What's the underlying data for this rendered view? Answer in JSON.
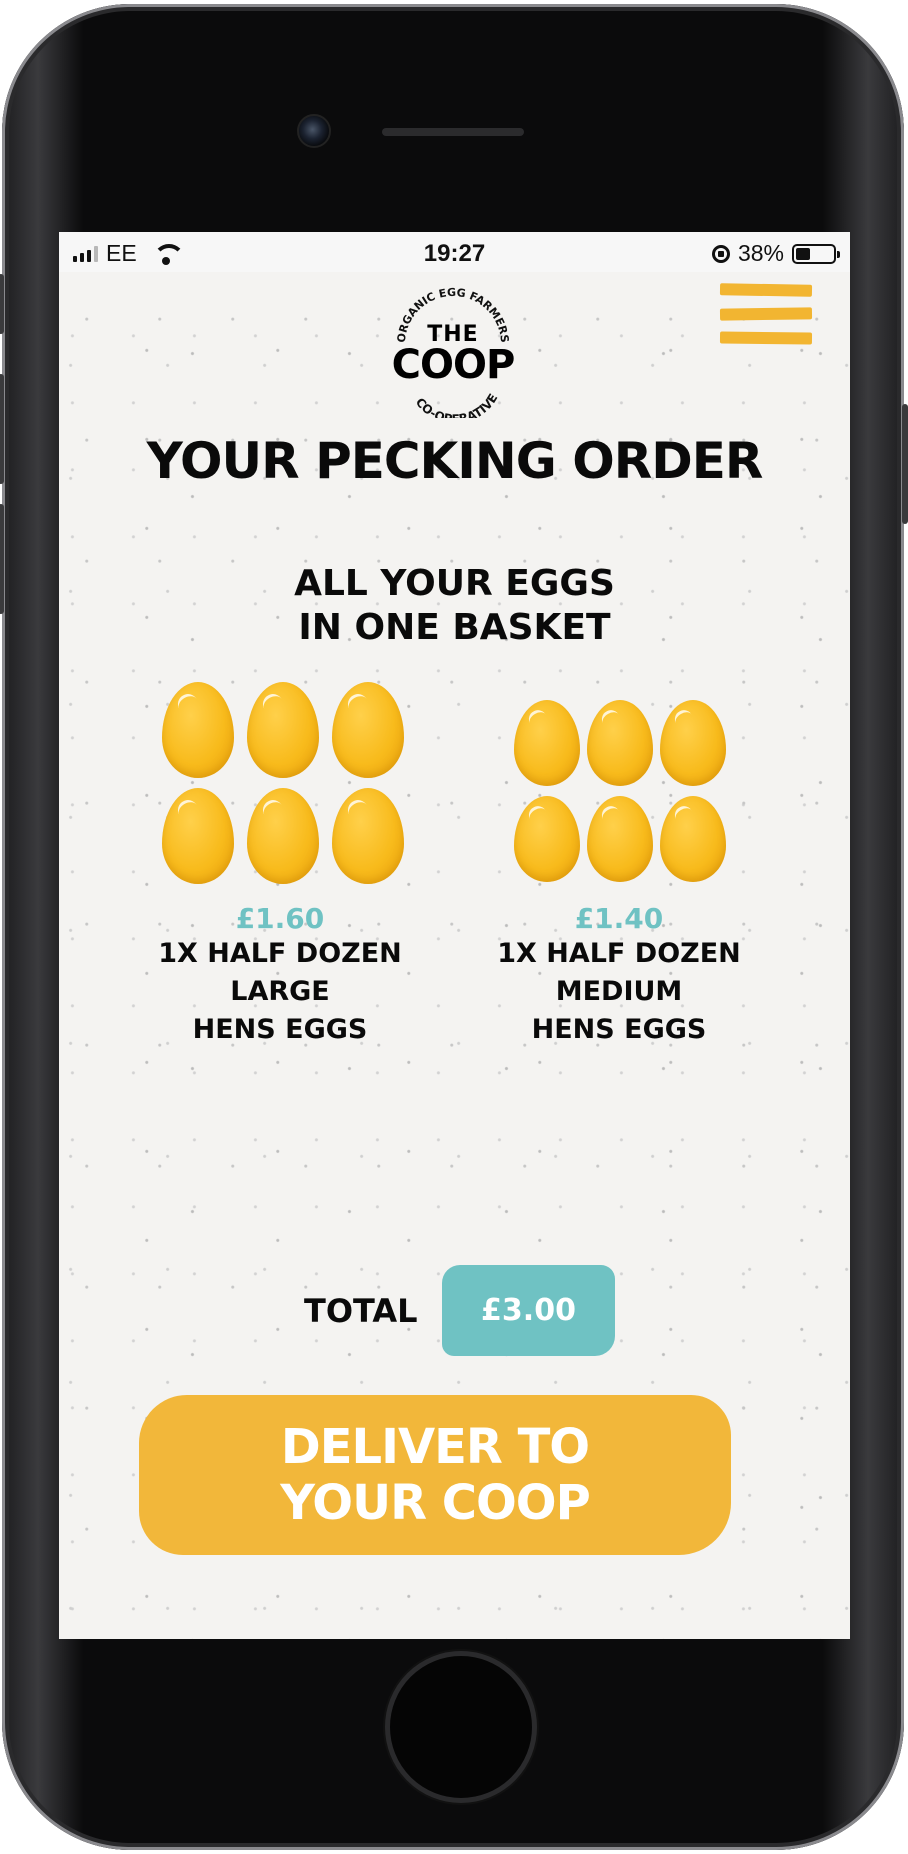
{
  "status_bar": {
    "carrier": "EE",
    "time": "19:27",
    "battery_percent": "38%",
    "battery_level": 0.38,
    "signal_bars_active": 3,
    "icons": [
      "signal-icon",
      "wifi-icon",
      "rotation-lock-icon",
      "battery-icon"
    ]
  },
  "logo": {
    "arc_top": "ORGANIC EGG FARMERS",
    "line1": "THE",
    "line2": "COOP",
    "arc_bottom": "CO-OPERATIVE"
  },
  "menu": {
    "icon": "hamburger-menu-icon"
  },
  "page": {
    "title": "YOUR PECKING ORDER",
    "subtitle_line1": "ALL YOUR EGGS",
    "subtitle_line2": "IN ONE BASKET"
  },
  "products": [
    {
      "price": "£1.60",
      "line1": "1X HALF DOZEN",
      "line2": "LARGE",
      "line3": "HENS EGGS",
      "egg_count": 6
    },
    {
      "price": "£1.40",
      "line1": "1X HALF DOZEN",
      "line2": "MEDIUM",
      "line3": "HENS EGGS",
      "egg_count": 6
    }
  ],
  "total": {
    "label": "TOTAL",
    "value": "£3.00"
  },
  "cta": {
    "line1": "DELIVER TO",
    "line2": "YOUR COOP"
  },
  "colors": {
    "accent_yellow": "#f2b73a",
    "accent_teal": "#6fc2c3",
    "egg_yellow": "#f8bb1c",
    "text": "#0a0a0a",
    "background": "#f4f3f1"
  }
}
